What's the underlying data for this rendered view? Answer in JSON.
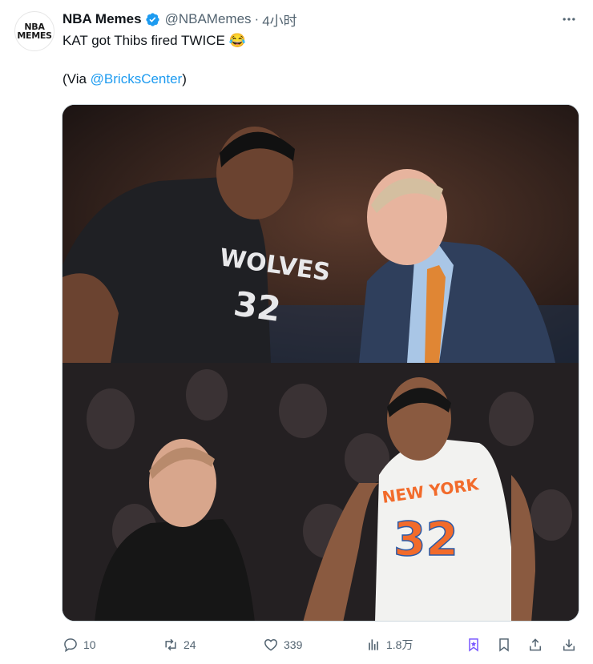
{
  "account": {
    "name": "NBA Memes",
    "handle": "@NBAMemes",
    "separator": "·",
    "time": "4小时",
    "avatar_text_line1": "NBA",
    "avatar_text_line2": "MEMES"
  },
  "tweet": {
    "line1": "KAT got Thibs fired TWICE 😂",
    "via_prefix": "(Via ",
    "via_link": "@BricksCenter",
    "via_suffix": ")"
  },
  "media": {
    "top_jersey_text": "WOLVES",
    "top_jersey_number": "32",
    "bottom_jersey_text": "NEW YORK",
    "bottom_jersey_number": "32"
  },
  "actions": {
    "replies": "10",
    "reposts": "24",
    "likes": "339",
    "views": "1.8万"
  },
  "colors": {
    "accent": "#1d9bf0",
    "muted": "#536471",
    "verified": "#1d9bf0",
    "premium": "#7856ff"
  }
}
